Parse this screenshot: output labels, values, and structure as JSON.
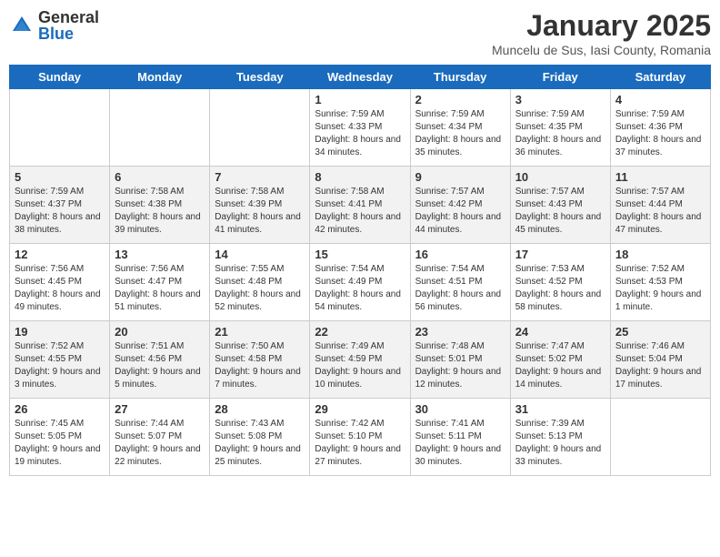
{
  "header": {
    "logo_general": "General",
    "logo_blue": "Blue",
    "title": "January 2025",
    "subtitle": "Muncelu de Sus, Iasi County, Romania"
  },
  "days_of_week": [
    "Sunday",
    "Monday",
    "Tuesday",
    "Wednesday",
    "Thursday",
    "Friday",
    "Saturday"
  ],
  "weeks": [
    {
      "cells": [
        {
          "day": null
        },
        {
          "day": null
        },
        {
          "day": null
        },
        {
          "day": "1",
          "sunrise": "Sunrise: 7:59 AM",
          "sunset": "Sunset: 4:33 PM",
          "daylight": "Daylight: 8 hours and 34 minutes."
        },
        {
          "day": "2",
          "sunrise": "Sunrise: 7:59 AM",
          "sunset": "Sunset: 4:34 PM",
          "daylight": "Daylight: 8 hours and 35 minutes."
        },
        {
          "day": "3",
          "sunrise": "Sunrise: 7:59 AM",
          "sunset": "Sunset: 4:35 PM",
          "daylight": "Daylight: 8 hours and 36 minutes."
        },
        {
          "day": "4",
          "sunrise": "Sunrise: 7:59 AM",
          "sunset": "Sunset: 4:36 PM",
          "daylight": "Daylight: 8 hours and 37 minutes."
        }
      ]
    },
    {
      "cells": [
        {
          "day": "5",
          "sunrise": "Sunrise: 7:59 AM",
          "sunset": "Sunset: 4:37 PM",
          "daylight": "Daylight: 8 hours and 38 minutes."
        },
        {
          "day": "6",
          "sunrise": "Sunrise: 7:58 AM",
          "sunset": "Sunset: 4:38 PM",
          "daylight": "Daylight: 8 hours and 39 minutes."
        },
        {
          "day": "7",
          "sunrise": "Sunrise: 7:58 AM",
          "sunset": "Sunset: 4:39 PM",
          "daylight": "Daylight: 8 hours and 41 minutes."
        },
        {
          "day": "8",
          "sunrise": "Sunrise: 7:58 AM",
          "sunset": "Sunset: 4:41 PM",
          "daylight": "Daylight: 8 hours and 42 minutes."
        },
        {
          "day": "9",
          "sunrise": "Sunrise: 7:57 AM",
          "sunset": "Sunset: 4:42 PM",
          "daylight": "Daylight: 8 hours and 44 minutes."
        },
        {
          "day": "10",
          "sunrise": "Sunrise: 7:57 AM",
          "sunset": "Sunset: 4:43 PM",
          "daylight": "Daylight: 8 hours and 45 minutes."
        },
        {
          "day": "11",
          "sunrise": "Sunrise: 7:57 AM",
          "sunset": "Sunset: 4:44 PM",
          "daylight": "Daylight: 8 hours and 47 minutes."
        }
      ]
    },
    {
      "cells": [
        {
          "day": "12",
          "sunrise": "Sunrise: 7:56 AM",
          "sunset": "Sunset: 4:45 PM",
          "daylight": "Daylight: 8 hours and 49 minutes."
        },
        {
          "day": "13",
          "sunrise": "Sunrise: 7:56 AM",
          "sunset": "Sunset: 4:47 PM",
          "daylight": "Daylight: 8 hours and 51 minutes."
        },
        {
          "day": "14",
          "sunrise": "Sunrise: 7:55 AM",
          "sunset": "Sunset: 4:48 PM",
          "daylight": "Daylight: 8 hours and 52 minutes."
        },
        {
          "day": "15",
          "sunrise": "Sunrise: 7:54 AM",
          "sunset": "Sunset: 4:49 PM",
          "daylight": "Daylight: 8 hours and 54 minutes."
        },
        {
          "day": "16",
          "sunrise": "Sunrise: 7:54 AM",
          "sunset": "Sunset: 4:51 PM",
          "daylight": "Daylight: 8 hours and 56 minutes."
        },
        {
          "day": "17",
          "sunrise": "Sunrise: 7:53 AM",
          "sunset": "Sunset: 4:52 PM",
          "daylight": "Daylight: 8 hours and 58 minutes."
        },
        {
          "day": "18",
          "sunrise": "Sunrise: 7:52 AM",
          "sunset": "Sunset: 4:53 PM",
          "daylight": "Daylight: 9 hours and 1 minute."
        }
      ]
    },
    {
      "cells": [
        {
          "day": "19",
          "sunrise": "Sunrise: 7:52 AM",
          "sunset": "Sunset: 4:55 PM",
          "daylight": "Daylight: 9 hours and 3 minutes."
        },
        {
          "day": "20",
          "sunrise": "Sunrise: 7:51 AM",
          "sunset": "Sunset: 4:56 PM",
          "daylight": "Daylight: 9 hours and 5 minutes."
        },
        {
          "day": "21",
          "sunrise": "Sunrise: 7:50 AM",
          "sunset": "Sunset: 4:58 PM",
          "daylight": "Daylight: 9 hours and 7 minutes."
        },
        {
          "day": "22",
          "sunrise": "Sunrise: 7:49 AM",
          "sunset": "Sunset: 4:59 PM",
          "daylight": "Daylight: 9 hours and 10 minutes."
        },
        {
          "day": "23",
          "sunrise": "Sunrise: 7:48 AM",
          "sunset": "Sunset: 5:01 PM",
          "daylight": "Daylight: 9 hours and 12 minutes."
        },
        {
          "day": "24",
          "sunrise": "Sunrise: 7:47 AM",
          "sunset": "Sunset: 5:02 PM",
          "daylight": "Daylight: 9 hours and 14 minutes."
        },
        {
          "day": "25",
          "sunrise": "Sunrise: 7:46 AM",
          "sunset": "Sunset: 5:04 PM",
          "daylight": "Daylight: 9 hours and 17 minutes."
        }
      ]
    },
    {
      "cells": [
        {
          "day": "26",
          "sunrise": "Sunrise: 7:45 AM",
          "sunset": "Sunset: 5:05 PM",
          "daylight": "Daylight: 9 hours and 19 minutes."
        },
        {
          "day": "27",
          "sunrise": "Sunrise: 7:44 AM",
          "sunset": "Sunset: 5:07 PM",
          "daylight": "Daylight: 9 hours and 22 minutes."
        },
        {
          "day": "28",
          "sunrise": "Sunrise: 7:43 AM",
          "sunset": "Sunset: 5:08 PM",
          "daylight": "Daylight: 9 hours and 25 minutes."
        },
        {
          "day": "29",
          "sunrise": "Sunrise: 7:42 AM",
          "sunset": "Sunset: 5:10 PM",
          "daylight": "Daylight: 9 hours and 27 minutes."
        },
        {
          "day": "30",
          "sunrise": "Sunrise: 7:41 AM",
          "sunset": "Sunset: 5:11 PM",
          "daylight": "Daylight: 9 hours and 30 minutes."
        },
        {
          "day": "31",
          "sunrise": "Sunrise: 7:39 AM",
          "sunset": "Sunset: 5:13 PM",
          "daylight": "Daylight: 9 hours and 33 minutes."
        },
        {
          "day": null
        }
      ]
    }
  ]
}
